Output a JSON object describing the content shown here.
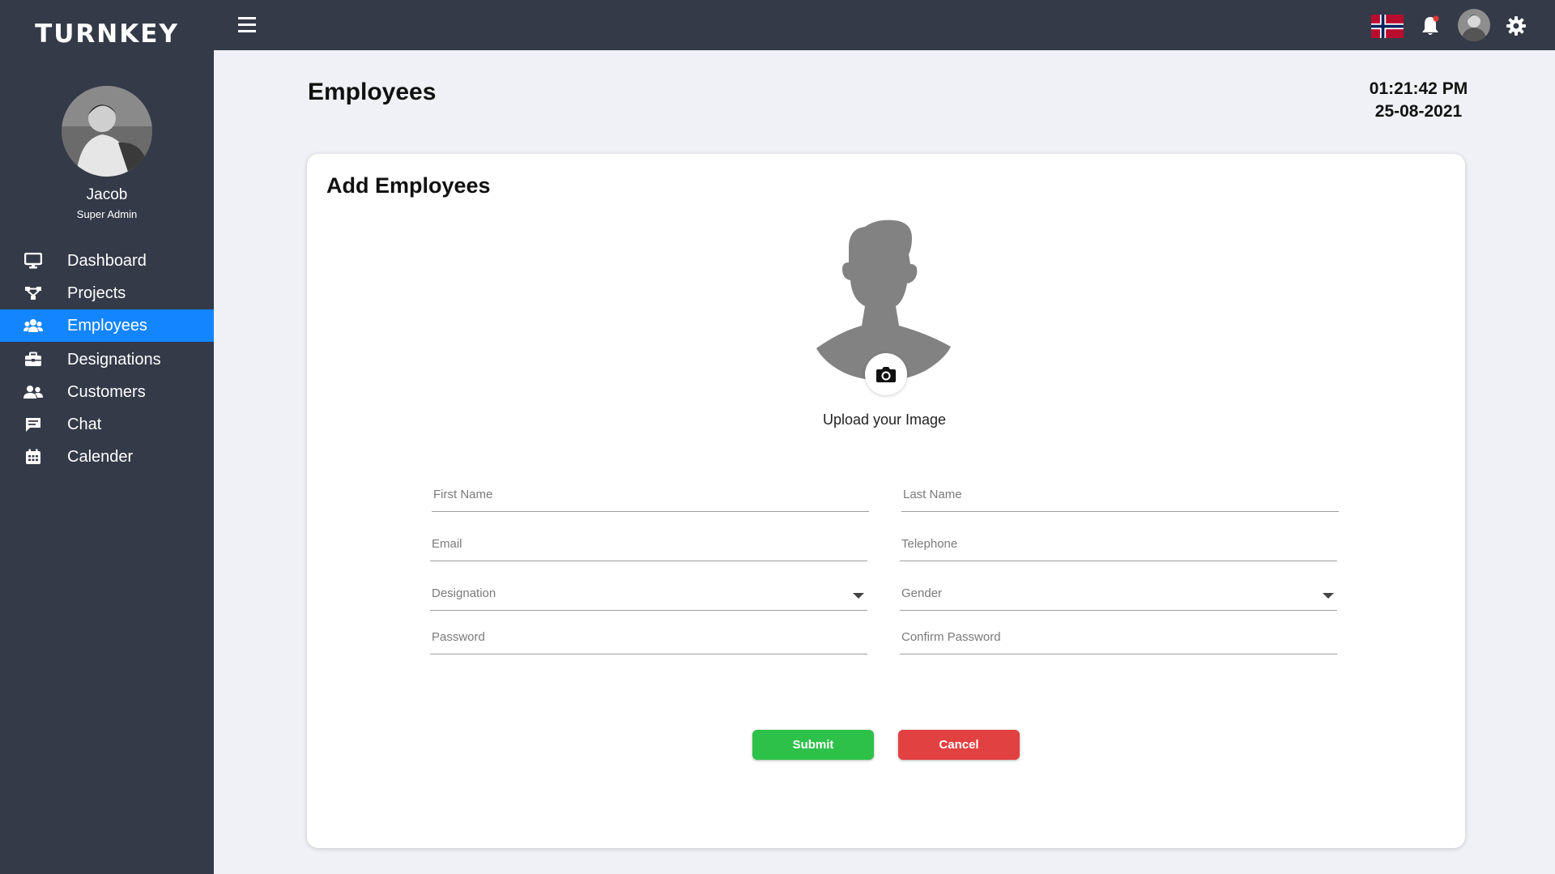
{
  "app": {
    "logo": "TURNKEY"
  },
  "user": {
    "name": "Jacob",
    "role": "Super Admin"
  },
  "sidebar": {
    "items": [
      {
        "label": "Dashboard",
        "icon": "monitor-icon"
      },
      {
        "label": "Projects",
        "icon": "sitemap-icon"
      },
      {
        "label": "Employees",
        "icon": "users-icon",
        "active": true
      },
      {
        "label": "Designations",
        "icon": "briefcase-icon"
      },
      {
        "label": "Customers",
        "icon": "user-friends-icon"
      },
      {
        "label": "Chat",
        "icon": "chat-icon"
      },
      {
        "label": "Calender",
        "icon": "calendar-icon"
      }
    ]
  },
  "topbar": {
    "icons": [
      "menu-icon",
      "norway-flag-icon",
      "bell-icon",
      "user-avatar",
      "gear-icon"
    ]
  },
  "page": {
    "title": "Employees",
    "time": "01:21:42 PM",
    "date": "25-08-2021"
  },
  "form": {
    "title": "Add Employees",
    "upload_label": "Upload your Image",
    "fields": {
      "first_name": "First Name",
      "last_name": "Last Name",
      "email": "Email",
      "telephone": "Telephone",
      "designation": "Designation",
      "gender": "Gender",
      "password": "Password",
      "confirm_password": "Confirm Password"
    },
    "submit_label": "Submit",
    "cancel_label": "Cancel"
  },
  "colors": {
    "sidebar": "#343a48",
    "accent": "#1385ff",
    "submit": "#2ec14a",
    "cancel": "#e24141",
    "background": "#f0f1f6"
  }
}
